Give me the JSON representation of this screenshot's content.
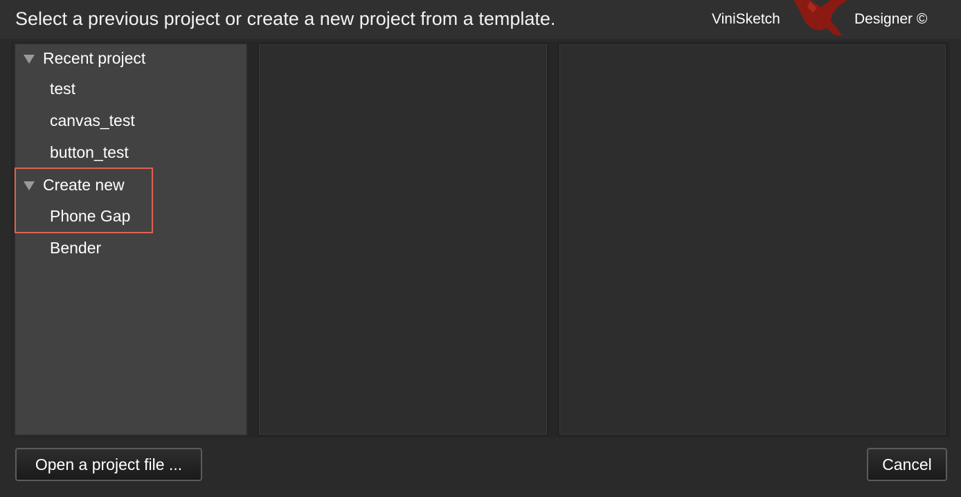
{
  "header": {
    "title": "Select a previous project or create a new project from a template.",
    "brand_name": "ViniSketch",
    "brand_suffix": "Designer ©",
    "logo_icon": "bird-logo-icon"
  },
  "sidebar": {
    "recent": {
      "label": "Recent project",
      "items": [
        "test",
        "canvas_test",
        "button_test"
      ]
    },
    "create": {
      "label": "Create new",
      "items": [
        "Phone Gap",
        "Bender"
      ]
    }
  },
  "footer": {
    "open_label": "Open a project file ...",
    "cancel_label": "Cancel"
  },
  "colors": {
    "background": "#2a2a2a",
    "sidebar": "#424242",
    "panel": "#2d2d2d",
    "highlight": "#e0614f",
    "logo": "#8b1a12"
  }
}
